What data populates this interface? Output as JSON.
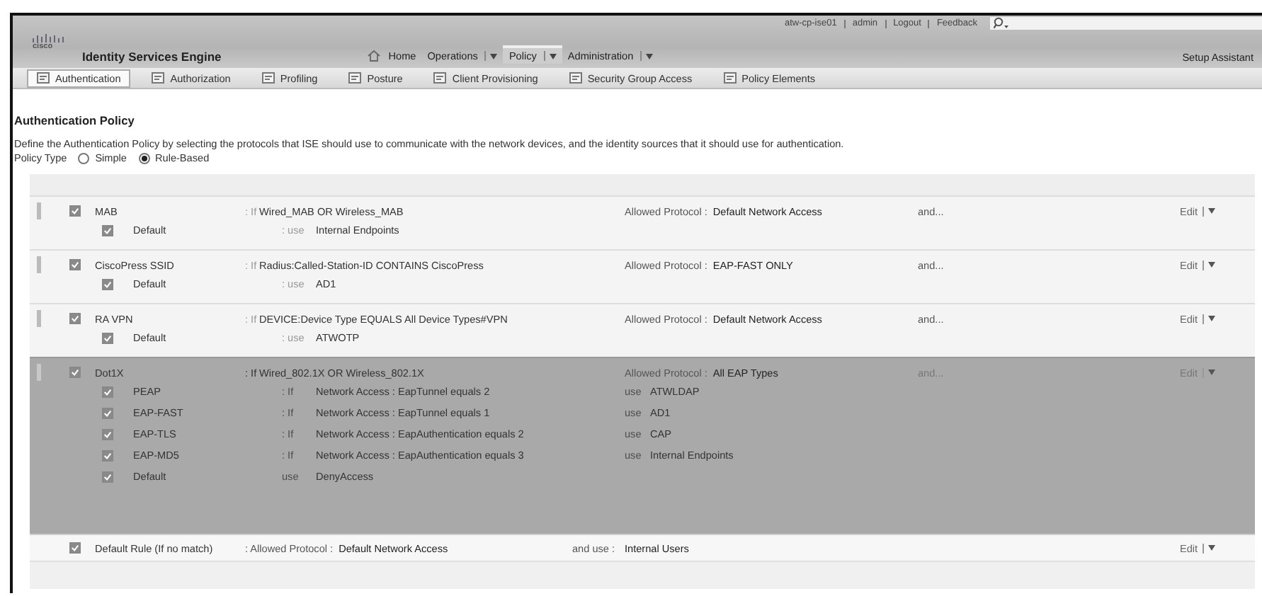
{
  "header": {
    "user_links": [
      "atw-cp-ise01",
      "admin",
      "Logout",
      "Feedback"
    ],
    "logo_text": "cisco",
    "title": "Identity Services Engine",
    "nav": [
      {
        "kind": "home",
        "label": "Home",
        "selected": false
      },
      {
        "kind": "menu",
        "label": "Operations",
        "selected": false
      },
      {
        "kind": "menu",
        "label": "Policy",
        "selected": true
      },
      {
        "kind": "menu",
        "label": "Administration",
        "selected": false
      }
    ],
    "setup_assistant": "Setup Assistant"
  },
  "tabs": [
    {
      "label": "Authentication",
      "selected": true
    },
    {
      "label": "Authorization",
      "selected": false
    },
    {
      "label": "Profiling",
      "selected": false
    },
    {
      "label": "Posture",
      "selected": false
    },
    {
      "label": "Client Provisioning",
      "selected": false
    },
    {
      "label": "Security Group Access",
      "selected": false
    },
    {
      "label": "Policy Elements",
      "selected": false
    }
  ],
  "policy": {
    "title": "Authentication Policy",
    "description": "Define the Authentication Policy by selecting the protocols that ISE should use to communicate with the network devices, and the identity sources that it should use for authentication.",
    "policy_type_label": "Policy Type",
    "policy_types": [
      {
        "label": "Simple",
        "selected": false
      },
      {
        "label": "Rule-Based",
        "selected": true
      }
    ]
  },
  "rules": [
    {
      "name": "MAB",
      "enabled": true,
      "selected": false,
      "if_label": ": If",
      "condition": "Wired_MAB OR Wireless_MAB",
      "protocol_label": "Allowed Protocol :",
      "protocol": "Default Network Access",
      "options": "and...",
      "edit": "Edit",
      "sub_rules": [
        {
          "kind": "default",
          "name": "Default",
          "enabled": true,
          "use_label": ": use",
          "source": "Internal Endpoints"
        }
      ]
    },
    {
      "name": "CiscoPress SSID",
      "enabled": true,
      "selected": false,
      "if_label": ": If",
      "condition": "Radius:Called-Station-ID CONTAINS CiscoPress",
      "protocol_label": "Allowed Protocol :",
      "protocol": "EAP-FAST ONLY",
      "options": "and...",
      "edit": "Edit",
      "sub_rules": [
        {
          "kind": "default",
          "name": "Default",
          "enabled": true,
          "use_label": ": use",
          "source": "AD1"
        }
      ]
    },
    {
      "name": "RA VPN",
      "enabled": true,
      "selected": false,
      "if_label": ": If",
      "condition": "DEVICE:Device Type EQUALS All Device Types#VPN",
      "protocol_label": "Allowed Protocol :",
      "protocol": "Default Network Access",
      "options": "and...",
      "edit": "Edit",
      "sub_rules": [
        {
          "kind": "default",
          "name": "Default",
          "enabled": true,
          "use_label": ": use",
          "source": "ATWOTP"
        }
      ]
    },
    {
      "name": "Dot1X",
      "enabled": true,
      "selected": true,
      "if_label": ": If",
      "condition": "Wired_802.1X OR Wireless_802.1X",
      "protocol_label": "Allowed Protocol :",
      "protocol": "All EAP Types",
      "options": "and...",
      "edit": "Edit",
      "sub_rules": [
        {
          "kind": "conditional",
          "name": "PEAP",
          "enabled": true,
          "if_label": ": If",
          "condition": "Network Access : EapTunnel equals 2",
          "use_label": "use",
          "source": "ATWLDAP"
        },
        {
          "kind": "conditional",
          "name": "EAP-FAST",
          "enabled": true,
          "if_label": ": If",
          "condition": "Network Access : EapTunnel equals 1",
          "use_label": "use",
          "source": "AD1"
        },
        {
          "kind": "conditional",
          "name": "EAP-TLS",
          "enabled": true,
          "if_label": ": If",
          "condition": "Network Access : EapAuthentication equals 2",
          "use_label": "use",
          "source": "CAP"
        },
        {
          "kind": "conditional",
          "name": "EAP-MD5",
          "enabled": true,
          "if_label": ": If",
          "condition": "Network Access : EapAuthentication equals 3",
          "use_label": "use",
          "source": "Internal Endpoints"
        },
        {
          "kind": "default",
          "name": "Default",
          "enabled": true,
          "use_label": "use",
          "source": "DenyAccess"
        }
      ]
    }
  ],
  "default_rule": {
    "name": "Default Rule (If no match)",
    "enabled": true,
    "protocol_label": ": Allowed Protocol :",
    "protocol": "Default Network Access",
    "use_label": "and use :",
    "source": "Internal Users",
    "edit": "Edit"
  }
}
